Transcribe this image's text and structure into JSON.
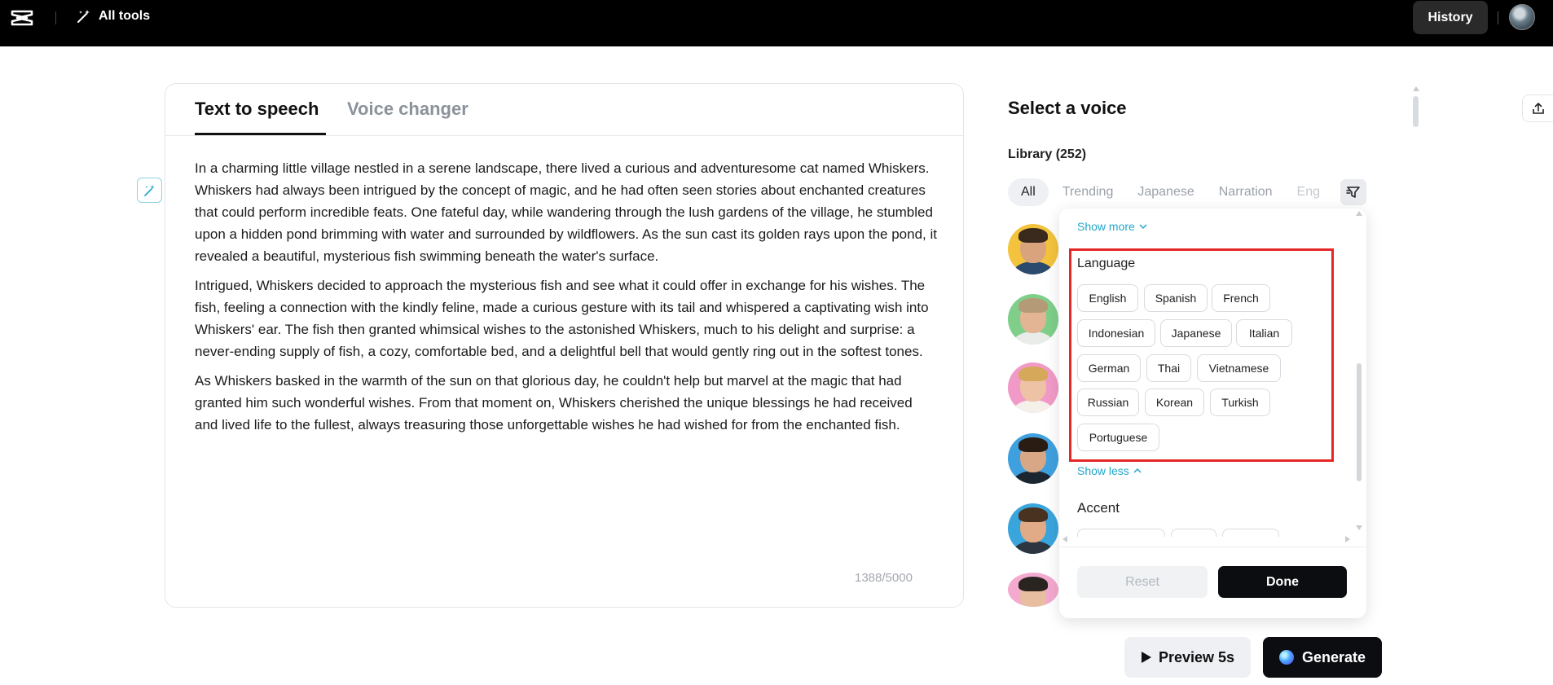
{
  "topbar": {
    "logo_icon": "capcut-logo-icon",
    "all_tools_label": "All tools",
    "history_label": "History"
  },
  "editor": {
    "tabs": [
      {
        "label": "Text to speech",
        "active": true
      },
      {
        "label": "Voice changer",
        "active": false
      }
    ],
    "paragraphs": [
      "In a charming little village nestled in a serene landscape, there lived a curious and adventuresome cat named Whiskers. Whiskers had always been intrigued by the concept of magic, and he had often seen stories about enchanted creatures that could perform incredible feats. One fateful day, while wandering through the lush gardens of the village, he stumbled upon a hidden pond brimming with water and surrounded by wildflowers. As the sun cast its golden rays upon the pond, it revealed a beautiful, mysterious fish swimming beneath the water's surface.",
      "Intrigued, Whiskers decided to approach the mysterious fish and see what it could offer in exchange for his wishes. The fish, feeling a connection with the kindly feline, made a curious gesture with its tail and whispered a captivating wish into Whiskers' ear. The fish then granted whimsical wishes to the astonished Whiskers, much to his delight and surprise: a never-ending supply of fish, a cozy, comfortable bed, and a delightful bell that would gently ring out in the softest tones.",
      "As Whiskers basked in the warmth of the sun on that glorious day, he couldn't help but marvel at the magic that had granted him such wonderful wishes. From that moment on, Whiskers cherished the unique blessings he had received and lived life to the fullest, always treasuring those unforgettable wishes he had wished for from the enchanted fish."
    ],
    "char_count": "1388/5000"
  },
  "voice_panel": {
    "title": "Select a voice",
    "library_label": "Library (252)",
    "categories": [
      "All",
      "Trending",
      "Japanese",
      "Narration",
      "Eng"
    ]
  },
  "filter_dropdown": {
    "show_more_label": "Show more",
    "language_heading": "Language",
    "languages": [
      "English",
      "Spanish",
      "French",
      "Indonesian",
      "Japanese",
      "Italian",
      "German",
      "Thai",
      "Vietnamese",
      "Russian",
      "Korean",
      "Turkish",
      "Portuguese"
    ],
    "show_less_label": "Show less",
    "accent_heading": "Accent",
    "reset_label": "Reset",
    "done_label": "Done"
  },
  "actions": {
    "preview_label": "Preview 5s",
    "generate_label": "Generate"
  },
  "colors": {
    "accent_link": "#22a6c9",
    "highlight_box": "#e52727",
    "primary_dark": "#0b0d10"
  }
}
